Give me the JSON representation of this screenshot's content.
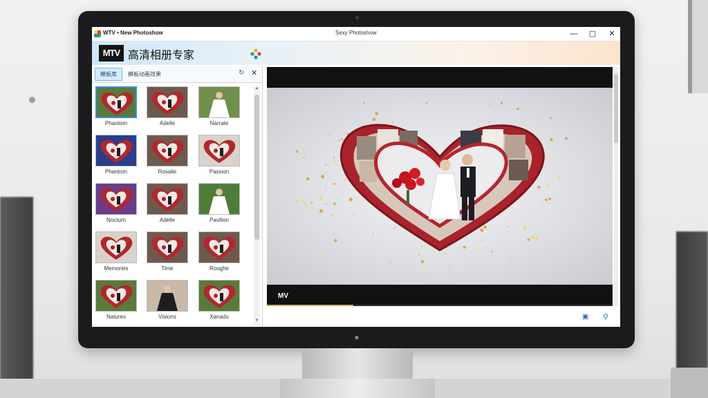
{
  "window": {
    "title_left": "WTV • New Photoshow",
    "title_center": "Sexy Photoshow",
    "minimize": "—",
    "maximize": "▢",
    "close": "✕"
  },
  "banner": {
    "logo": "MTV",
    "title": "高清相册专家"
  },
  "panel": {
    "tabs": [
      {
        "label": "模板库"
      },
      {
        "label": "模板动画效果"
      }
    ],
    "refresh": "↻",
    "close": "✕",
    "thumbnails": [
      {
        "label": "Phantom",
        "style": "heart-couple"
      },
      {
        "label": "Adelle",
        "style": "heart-rose"
      },
      {
        "label": "Narrate",
        "style": "bride"
      },
      {
        "label": "Phantom",
        "style": "heart-blue"
      },
      {
        "label": "Rosalie",
        "style": "heart-rose"
      },
      {
        "label": "Passion",
        "style": "heart-light"
      },
      {
        "label": "Nocturn",
        "style": "heart-purple"
      },
      {
        "label": "Adelle",
        "style": "heart-rose"
      },
      {
        "label": "Pavilion",
        "style": "bride-green"
      },
      {
        "label": "Memories",
        "style": "heart-light"
      },
      {
        "label": "Time",
        "style": "heart-rose"
      },
      {
        "label": "Roughe",
        "style": "heart-rose"
      },
      {
        "label": "Natures",
        "style": "heart-couple"
      },
      {
        "label": "Visions",
        "style": "couple"
      },
      {
        "label": "Xanadu",
        "style": "heart-couple"
      }
    ],
    "selected_index": 0
  },
  "preview": {
    "logo": "MV",
    "progress": 0.25
  },
  "colors": {
    "heart_red": "#b3262d",
    "accent_blue": "#3a8ee6",
    "gold": "#d6a860"
  }
}
